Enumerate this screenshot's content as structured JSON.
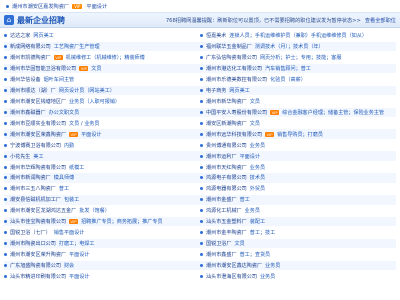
{
  "top_row": {
    "company": "潮州市潮安区嘉发陶瓷厂",
    "badge": "VIP",
    "job": "平面设计"
  },
  "header": {
    "title": "最新企业招聘",
    "notice": "768招聘网温馨提醒：刷新职位可以置顶，已不需要招聘的职位建议发为暂停状态>>",
    "more": "查看全部职位"
  },
  "left": [
    {
      "company": "达达之家",
      "jobs": "网页美工"
    },
    {
      "company": "新成网络有限公司",
      "jobs": "工艺陶瓷厂生产管理"
    },
    {
      "company": "潮州市凯德陶瓷厂",
      "badge": "VIP",
      "jobs": "机械维修工（机械维修）；精装师傅"
    },
    {
      "company": "潮州市华固智能卫浴有限公司",
      "badge": "VIP",
      "jobs": "文员"
    },
    {
      "company": "潮州华信设备",
      "jobs": "烟叶车间主管"
    },
    {
      "company": "潮州市顺达（湖）厂",
      "jobs": "网页设计员（网站美工）"
    },
    {
      "company": "潮州市潮安区钱塘地区厂",
      "jobs": "业务员（入职可报销）"
    },
    {
      "company": "潮州市鑫磁器厂",
      "jobs": "办公文职文员"
    },
    {
      "company": "潮州市豆顺实业有限公司",
      "jobs": "文员 / 业务员"
    },
    {
      "company": "潮州市潮安区荣鑫陶瓷厂",
      "badge": "VIP",
      "jobs": "平面设计"
    },
    {
      "company": "宁波博赛卫浴有限公司",
      "jobs": "内勤"
    },
    {
      "company": "小花先生",
      "jobs": "美工"
    },
    {
      "company": "潮州市华辉陶瓷有限公司",
      "jobs": "纸模工"
    },
    {
      "company": "潮州市新润陶瓷厂",
      "jobs": "模具师傅"
    },
    {
      "company": "潮州市三五八陶瓷厂",
      "jobs": "普工"
    },
    {
      "company": "潮安县信磁机机加工厂",
      "jobs": "包装工"
    },
    {
      "company": "潮州市潮安区龙湖鸿达五金厂",
      "jobs": "批发（饱餐）"
    },
    {
      "company": "汕头市佳宝陶瓷有限公司",
      "badge": "VIP",
      "jobs": "招聘推广专员；商务拓展；推广专员"
    },
    {
      "company": "国锐卫浴（七厂）",
      "jobs": "销售平面设计"
    },
    {
      "company": "潮州市陶瓷出口公司",
      "jobs": "打磨工；电焊工"
    },
    {
      "company": "潮州市潮安区荣升陶瓷厂",
      "jobs": "平面设计"
    },
    {
      "company": "广东旭盛陶瓷有限公司",
      "jobs": "财会"
    },
    {
      "company": "汕头市精进印刷有限公司",
      "jobs": "平面设计"
    }
  ],
  "right": [
    {
      "company": "恒嘉美术",
      "jobs": "连锁人员；手机运维维护员（兼职）手机运维维修员（如从）"
    },
    {
      "company": "福州联华五金制品厂",
      "jobs": "测调技术（月）；技术员（年）"
    },
    {
      "company": "广东弘信陶瓷有限公司",
      "jobs": "网页分析；护士；专用；技能；客服"
    },
    {
      "company": "潮州市港达化工有限公司",
      "jobs": "汽车销售顾问；普工"
    },
    {
      "company": "潮州市乐德美数控有限公司",
      "jobs": "化验员（高薪）"
    },
    {
      "company": "电子商务",
      "jobs": "网页美工"
    },
    {
      "company": "潮州市新华陶瓷厂",
      "jobs": "文员"
    },
    {
      "company": "中国平安人寿股份有限公司",
      "badge": "VIP",
      "jobs": "综合金融客户经理；储备主管；保险业务主管"
    },
    {
      "company": "潮安区新潮陶瓷厂",
      "jobs": "文员"
    },
    {
      "company": "潮州市远华科技有限公司",
      "badge": "VIP",
      "jobs": "销售导购员；打磨员"
    },
    {
      "company": "贵州博通有限公司",
      "jobs": "业务员"
    },
    {
      "company": "潮州市运利厂",
      "jobs": "平面设计"
    },
    {
      "company": "潮州市天红陶瓷厂",
      "jobs": "业务员"
    },
    {
      "company": "鸿源电子有限公司",
      "jobs": "技术员"
    },
    {
      "company": "鸿源电器有限公司",
      "jobs": "外贸员"
    },
    {
      "company": "潮州市金盛厂",
      "jobs": "普工"
    },
    {
      "company": "鸿源化工机械厂",
      "jobs": "业务员"
    },
    {
      "company": "汕头市五金塑料厂",
      "jobs": "装配工"
    },
    {
      "company": "潮州市金丰陶瓷厂",
      "jobs": "普工；技工"
    },
    {
      "company": "国锐卫浴厂",
      "jobs": "文员"
    },
    {
      "company": "潮州市鑫盛厂",
      "jobs": "普工；查货员"
    },
    {
      "company": "潮州市潮安区鑫达陶瓷厂",
      "jobs": "业务员"
    },
    {
      "company": "汕头市澄海区有限公司",
      "jobs": "业务员"
    }
  ]
}
